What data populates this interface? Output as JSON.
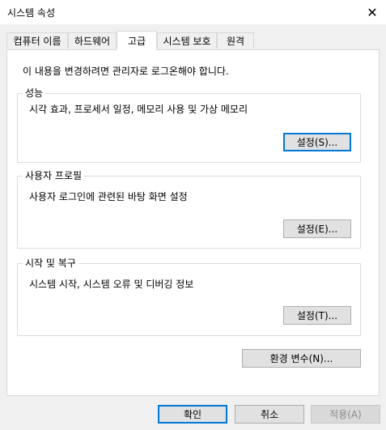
{
  "window": {
    "title": "시스템 속성",
    "close_glyph": "✕"
  },
  "tabs": [
    {
      "label": "컴퓨터 이름"
    },
    {
      "label": "하드웨어"
    },
    {
      "label": "고급"
    },
    {
      "label": "시스템 보호"
    },
    {
      "label": "원격"
    }
  ],
  "notice": "이 내용을 변경하려면 관리자로 로그온해야 합니다.",
  "performance": {
    "label": "성능",
    "description": "시각 효과, 프로세서 일정, 메모리 사용 및 가상 메모리",
    "button": "설정(S)..."
  },
  "user_profiles": {
    "label": "사용자 프로필",
    "description": "사용자 로그인에 관련된 바탕 화면 설정",
    "button": "설정(E)..."
  },
  "startup": {
    "label": "시작 및 복구",
    "description": "시스템 시작, 시스템 오류 및 디버깅 정보",
    "button": "설정(T)..."
  },
  "env_button": "환경 변수(N)...",
  "footer": {
    "ok": "확인",
    "cancel": "취소",
    "apply": "적용(A)"
  }
}
